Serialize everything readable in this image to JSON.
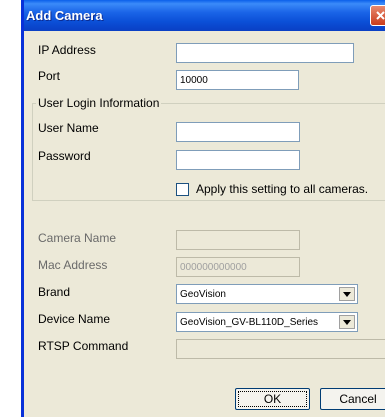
{
  "window": {
    "title": "Add Camera"
  },
  "fields": {
    "ip_address": {
      "label": "IP Address",
      "value": ""
    },
    "port": {
      "label": "Port",
      "value": "10000"
    }
  },
  "login_group": {
    "legend": "User Login Information",
    "user_name": {
      "label": "User Name",
      "value": ""
    },
    "password": {
      "label": "Password",
      "value": ""
    },
    "apply_all": {
      "label": "Apply this setting to all cameras.",
      "checked": false
    }
  },
  "camera": {
    "camera_name": {
      "label": "Camera Name",
      "value": ""
    },
    "mac_address": {
      "label": "Mac Address",
      "value": "000000000000"
    },
    "brand": {
      "label": "Brand",
      "selected": "GeoVision"
    },
    "device_name": {
      "label": "Device Name",
      "selected": "GeoVision_GV-BL110D_Series"
    },
    "rtsp_command": {
      "label": "RTSP Command",
      "value": ""
    }
  },
  "buttons": {
    "ok": "OK",
    "cancel": "Cancel"
  },
  "colors": {
    "title_bar": "#0b4fd7",
    "dialog_bg": "#ece9d8"
  }
}
